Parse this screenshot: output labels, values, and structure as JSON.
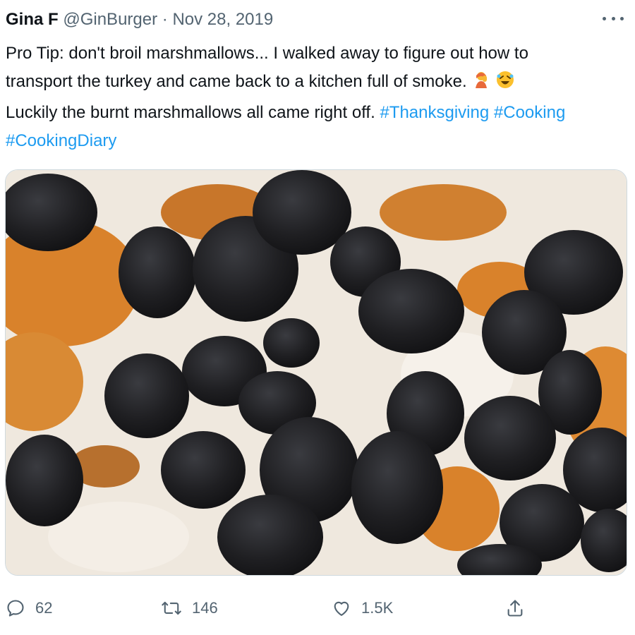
{
  "tweet": {
    "author_name": "Gina F",
    "handle": "@GinBurger",
    "separator": "·",
    "date": "Nov 28, 2019",
    "text_line1": "Pro Tip: don't broil marshmallows... I walked away to figure out how to",
    "text_line2": "transport the turkey and came back to a kitchen full of smoke.",
    "emoji1": "woman-facepalming",
    "emoji2": "rolling-on-floor-laughing",
    "text_line3": "Luckily the burnt marshmallows all came right off.",
    "hashtags": [
      "#Thanksgiving",
      "#Cooking",
      "#CookingDiary"
    ]
  },
  "media": {
    "description": "photo",
    "colors": {
      "sweet_potato": "#d9822b",
      "marshmallow": "#efe8de",
      "burnt": "#1f1f22"
    }
  },
  "actions": {
    "reply_count": "62",
    "retweet_count": "146",
    "like_count": "1.5K"
  },
  "colors": {
    "link": "#1d9bf0",
    "secondary_text": "#536471",
    "primary_text": "#0f1419"
  }
}
